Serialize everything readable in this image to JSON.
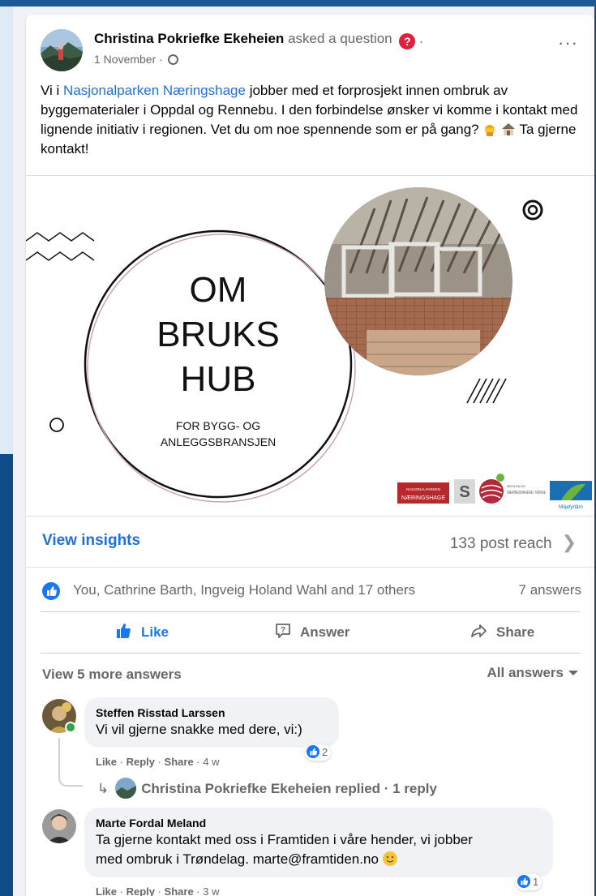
{
  "post": {
    "author": "Christina Pokriefke Ekeheien",
    "action": "asked a question",
    "date": "1 November",
    "text_pre": "Vi i ",
    "text_link": "Nasjonalparken Næringshage",
    "text_post": " jobber med et forprosjekt innen ombruk av byggematerialer i Oppdal og Rennebu. I den forbindelse ønsker vi komme i kontakt med lignende initiativ i regionen. Vet du om noe spennende som er på gang?",
    "text_end": " Ta gjerne kontakt!"
  },
  "image": {
    "line1": "OM",
    "line2": "BRUKS",
    "line3": "HUB",
    "sub1": "FOR BYGG- OG",
    "sub2": "ANLEGGSBRANSJEN",
    "logo1_top": "NASJONALPARKEN",
    "logo1_bottom": "NÆRINGSHAGE",
    "logo2": "S",
    "logo3": "NÆRINGSHAGENE I NORGE",
    "logo3_small": "MEDLEM AV",
    "logo4": "Miljøfyrtårn"
  },
  "stats": {
    "insights_label": "View insights",
    "reach": "133 post reach",
    "reactors": "You, Cathrine Barth, Ingveig Holand Wahl and 17 others",
    "answers": "7 answers"
  },
  "actions": {
    "like": "Like",
    "answer": "Answer",
    "share": "Share"
  },
  "comments_header": {
    "more": "View 5 more answers",
    "filter": "All answers"
  },
  "comments": [
    {
      "name": "Steffen Risstad Larssen",
      "text": "Vi vil gjerne snakke med dere, vi:)",
      "like": "Like",
      "reply": "Reply",
      "share": "Share",
      "age": "4 w",
      "reactions": "2",
      "replied_text": "Christina Pokriefke Ekeheien replied · 1 reply"
    },
    {
      "name": "Marte Fordal Meland",
      "text_line1": "Ta gjerne kontakt med oss i Framtiden i våre hender, vi jobber",
      "text_line2": "med ombruk i Trøndelag. marte@framtiden.no",
      "like": "Like",
      "reply": "Reply",
      "share": "Share",
      "age": "3 w",
      "reactions": "1"
    }
  ],
  "colors": {
    "brand_blue": "#1877f2",
    "link_blue": "#216fdb",
    "question_red": "#e41e3f",
    "text_secondary": "#65676b"
  }
}
